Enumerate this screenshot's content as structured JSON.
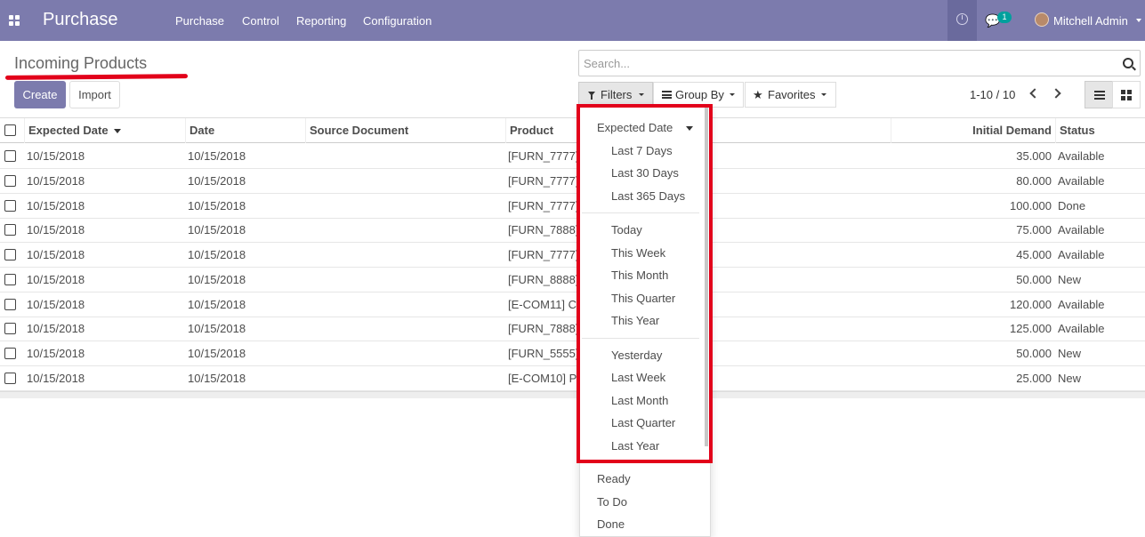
{
  "navbar": {
    "app_name": "Purchase",
    "menu": [
      "Purchase",
      "Control",
      "Reporting",
      "Configuration"
    ],
    "chat_badge": "1",
    "user_name": "Mitchell Admin",
    "background": "#7c7bad"
  },
  "page": {
    "title": "Incoming Products",
    "create_label": "Create",
    "import_label": "Import"
  },
  "search": {
    "placeholder": "Search..."
  },
  "controls": {
    "filters_label": "Filters",
    "groupby_label": "Group By",
    "favorites_label": "Favorites",
    "pager": "1-10 / 10"
  },
  "table": {
    "headers": {
      "expected_date": "Expected Date",
      "date": "Date",
      "source_document": "Source Document",
      "product": "Product",
      "initial_demand": "Initial Demand",
      "status": "Status"
    },
    "rows": [
      {
        "expected_date": "10/15/2018",
        "date": "10/15/2018",
        "source": "",
        "product": "[FURN_7777]",
        "demand": "35.000",
        "status": "Available"
      },
      {
        "expected_date": "10/15/2018",
        "date": "10/15/2018",
        "source": "",
        "product": "[FURN_7777]",
        "demand": "80.000",
        "status": "Available"
      },
      {
        "expected_date": "10/15/2018",
        "date": "10/15/2018",
        "source": "",
        "product": "[FURN_7777]",
        "demand": "100.000",
        "status": "Done"
      },
      {
        "expected_date": "10/15/2018",
        "date": "10/15/2018",
        "source": "",
        "product": "[FURN_7888]",
        "demand": "75.000",
        "status": "Available"
      },
      {
        "expected_date": "10/15/2018",
        "date": "10/15/2018",
        "source": "",
        "product": "[FURN_7777]",
        "demand": "45.000",
        "status": "Available"
      },
      {
        "expected_date": "10/15/2018",
        "date": "10/15/2018",
        "source": "",
        "product": "[FURN_8888]",
        "demand": "50.000",
        "status": "New"
      },
      {
        "expected_date": "10/15/2018",
        "date": "10/15/2018",
        "source": "",
        "product": "[E-COM11] C",
        "demand": "120.000",
        "status": "Available"
      },
      {
        "expected_date": "10/15/2018",
        "date": "10/15/2018",
        "source": "",
        "product": "[FURN_7888]",
        "demand": "125.000",
        "status": "Available"
      },
      {
        "expected_date": "10/15/2018",
        "date": "10/15/2018",
        "source": "",
        "product": "[FURN_5555]",
        "demand": "50.000",
        "status": "New"
      },
      {
        "expected_date": "10/15/2018",
        "date": "10/15/2018",
        "source": "",
        "product": "[E-COM10] P",
        "demand": "25.000",
        "status": "New"
      }
    ]
  },
  "filters_dropdown": {
    "group_header": "Expected Date",
    "group1": [
      "Last 7 Days",
      "Last 30 Days",
      "Last 365 Days"
    ],
    "group2": [
      "Today",
      "This Week",
      "This Month",
      "This Quarter",
      "This Year"
    ],
    "group3": [
      "Yesterday",
      "Last Week",
      "Last Month",
      "Last Quarter",
      "Last Year"
    ],
    "states": [
      "Ready",
      "To Do",
      "Done"
    ],
    "highlight_color": "#e2001a"
  }
}
